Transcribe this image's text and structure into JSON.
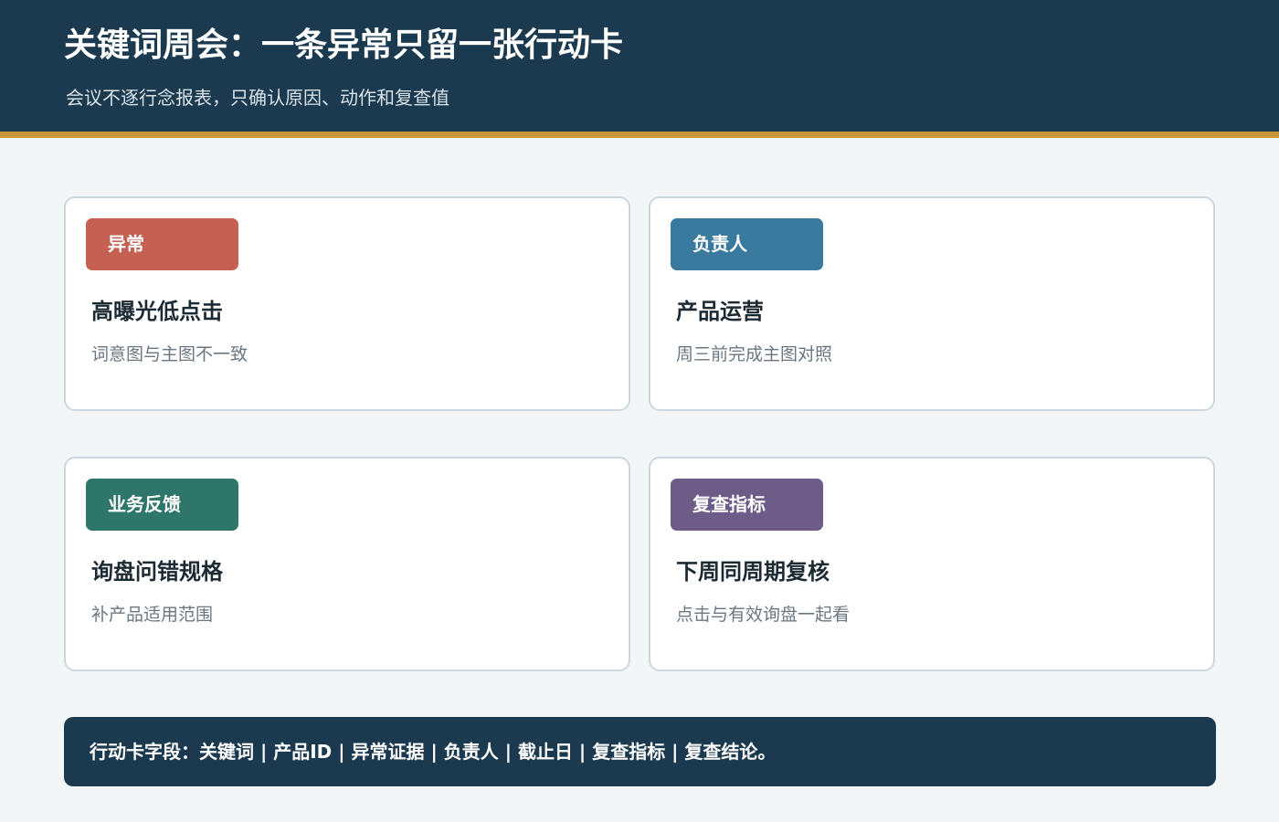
{
  "header": {
    "title": "关键词周会：一条异常只留一张行动卡",
    "subtitle": "会议不逐行念报表，只确认原因、动作和复查值"
  },
  "cards": [
    {
      "tag": "异常",
      "tag_color": "#c46152",
      "title": "高曝光低点击",
      "desc": "词意图与主图不一致"
    },
    {
      "tag": "负责人",
      "tag_color": "#3a7a9e",
      "title": "产品运营",
      "desc": "周三前完成主图对照"
    },
    {
      "tag": "业务反馈",
      "tag_color": "#2f766a",
      "title": "询盘问错规格",
      "desc": "补产品适用范围"
    },
    {
      "tag": "复查指标",
      "tag_color": "#6d5b88",
      "title": "下周同周期复核",
      "desc": "点击与有效询盘一起看"
    }
  ],
  "footer": {
    "text": "行动卡字段：关键词 | 产品ID | 异常证据 | 负责人 | 截止日 | 复查指标 | 复查结论。"
  },
  "colors": {
    "header_bg": "#1b3a4f",
    "accent": "#c9973a"
  }
}
